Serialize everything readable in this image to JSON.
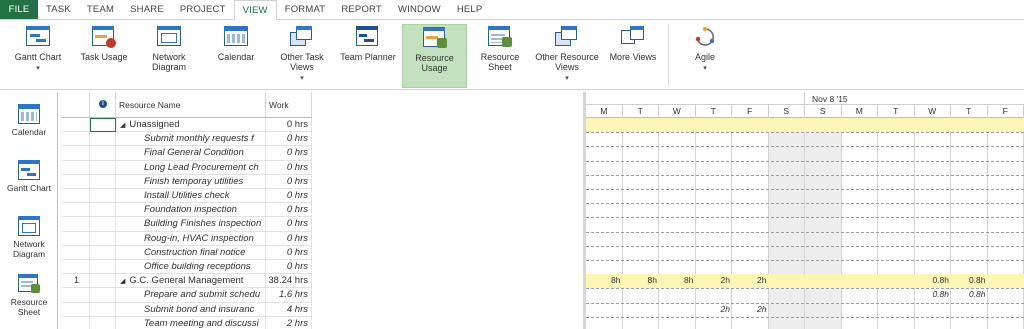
{
  "menu": [
    "FILE",
    "TASK",
    "TEAM",
    "SHARE",
    "PROJECT",
    "VIEW",
    "FORMAT",
    "REPORT",
    "WINDOW",
    "HELP"
  ],
  "ribbon": {
    "gantt_chart": "Gantt Chart",
    "task_usage": "Task Usage",
    "network_diagram": "Network Diagram",
    "calendar": "Calendar",
    "other_task_views": "Other Task Views",
    "team_planner": "Team Planner",
    "resource_usage": "Resource Usage",
    "resource_sheet": "Resource Sheet",
    "other_resource_views": "Other Resource Views",
    "more_views": "More Views",
    "agile": "Agile"
  },
  "viewbar": {
    "calendar": "Calendar",
    "gantt_chart": "Gantt Chart",
    "network_diagram": "Network Diagram",
    "resource_sheet": "Resource Sheet"
  },
  "sheet": {
    "columns": {
      "name": "Resource Name",
      "work": "Work"
    },
    "rows": [
      {
        "id": "",
        "name": "Unassigned",
        "work": "0 hrs",
        "type": "group"
      },
      {
        "id": "",
        "name": "Submit monthly requests f",
        "work": "0 hrs",
        "type": "task"
      },
      {
        "id": "",
        "name": "Final General Condition",
        "work": "0 hrs",
        "type": "task"
      },
      {
        "id": "",
        "name": "Long Lead Procurement ch",
        "work": "0 hrs",
        "type": "task"
      },
      {
        "id": "",
        "name": "Finish temporay utilities",
        "work": "0 hrs",
        "type": "task"
      },
      {
        "id": "",
        "name": "Install Utilities check",
        "work": "0 hrs",
        "type": "task"
      },
      {
        "id": "",
        "name": "Foundation inspection",
        "work": "0 hrs",
        "type": "task"
      },
      {
        "id": "",
        "name": "Building Finishes inspection",
        "work": "0 hrs",
        "type": "task"
      },
      {
        "id": "",
        "name": "Roug-in, HVAC  inspection",
        "work": "0 hrs",
        "type": "task"
      },
      {
        "id": "",
        "name": "Construction final notice",
        "work": "0 hrs",
        "type": "task"
      },
      {
        "id": "",
        "name": "Office building receptions",
        "work": "0 hrs",
        "type": "task"
      },
      {
        "id": "1",
        "name": "G.C. General Management",
        "work": "38.24 hrs",
        "type": "group"
      },
      {
        "id": "",
        "name": "Prepare and submit schedu",
        "work": "1.6 hrs",
        "type": "task"
      },
      {
        "id": "",
        "name": "Submit bond and insuranc",
        "work": "4 hrs",
        "type": "task"
      },
      {
        "id": "",
        "name": "Team meeting and discussi",
        "work": "2 hrs",
        "type": "task"
      }
    ]
  },
  "timescale": {
    "week_label": "Nov 8 '15",
    "days": [
      "M",
      "T",
      "W",
      "T",
      "F",
      "S",
      "S",
      "M",
      "T",
      "W",
      "T",
      "F"
    ],
    "gc_row_values": [
      "8h",
      "8h",
      "8h",
      "2h",
      "2h",
      "",
      "",
      "",
      "",
      "0.8h",
      "0.8h",
      ""
    ],
    "prepare_row_values": [
      "",
      "",
      "",
      "",
      "",
      "",
      "",
      "",
      "",
      "0.8h",
      "0.8h",
      ""
    ],
    "submit_row_values": [
      "",
      "",
      "",
      "2h",
      "2h",
      "",
      "",
      "",
      "",
      "",
      "",
      ""
    ]
  }
}
